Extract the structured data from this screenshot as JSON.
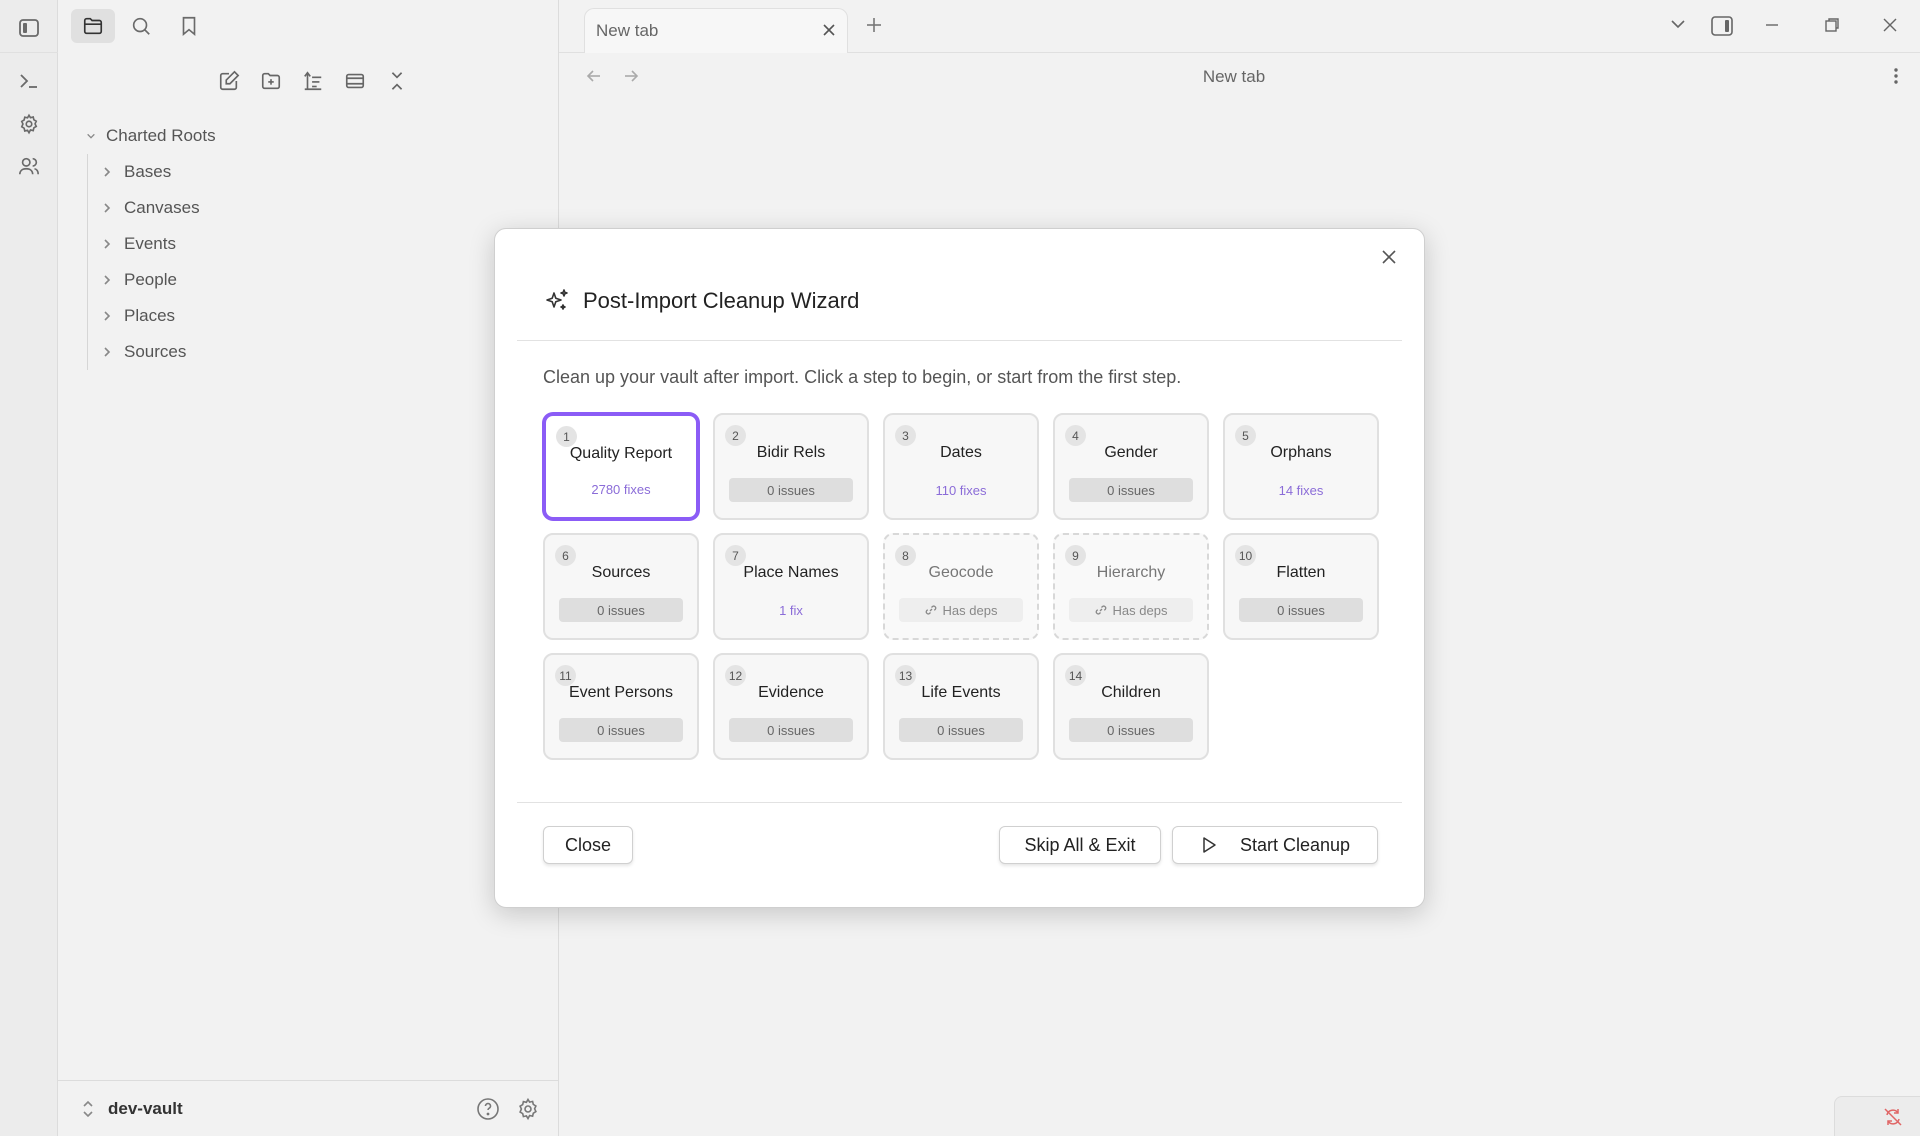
{
  "ribbon": {
    "icons": [
      "terminal-icon",
      "gear-icon",
      "people-icon"
    ]
  },
  "sidebar": {
    "tree_root": "Charted Roots",
    "tree_items": [
      "Bases",
      "Canvases",
      "Events",
      "People",
      "Places",
      "Sources"
    ],
    "vault_name": "dev-vault"
  },
  "tabs": {
    "active_tab": "New tab"
  },
  "main": {
    "view_title": "New tab"
  },
  "modal": {
    "title": "Post-Import Cleanup Wizard",
    "description": "Clean up your vault after import. Click a step to begin, or start from the first step.",
    "steps": [
      {
        "num": "1",
        "title": "Quality Report",
        "badge": "2780 fixes"
      },
      {
        "num": "2",
        "title": "Bidir Rels",
        "badge": "0 issues"
      },
      {
        "num": "3",
        "title": "Dates",
        "badge": "110 fixes"
      },
      {
        "num": "4",
        "title": "Gender",
        "badge": "0 issues"
      },
      {
        "num": "5",
        "title": "Orphans",
        "badge": "14 fixes"
      },
      {
        "num": "6",
        "title": "Sources",
        "badge": "0 issues"
      },
      {
        "num": "7",
        "title": "Place Names",
        "badge": "1 fix"
      },
      {
        "num": "8",
        "title": "Geocode",
        "badge": "Has deps"
      },
      {
        "num": "9",
        "title": "Hierarchy",
        "badge": "Has deps"
      },
      {
        "num": "10",
        "title": "Flatten",
        "badge": "0 issues"
      },
      {
        "num": "11",
        "title": "Event Persons",
        "badge": "0 issues"
      },
      {
        "num": "12",
        "title": "Evidence",
        "badge": "0 issues"
      },
      {
        "num": "13",
        "title": "Life Events",
        "badge": "0 issues"
      },
      {
        "num": "14",
        "title": "Children",
        "badge": "0 issues"
      }
    ],
    "buttons": {
      "close": "Close",
      "skip": "Skip All & Exit",
      "start": "Start Cleanup"
    }
  },
  "colors": {
    "accent": "#8b5cf6",
    "fix_text": "#8b6cd8"
  }
}
